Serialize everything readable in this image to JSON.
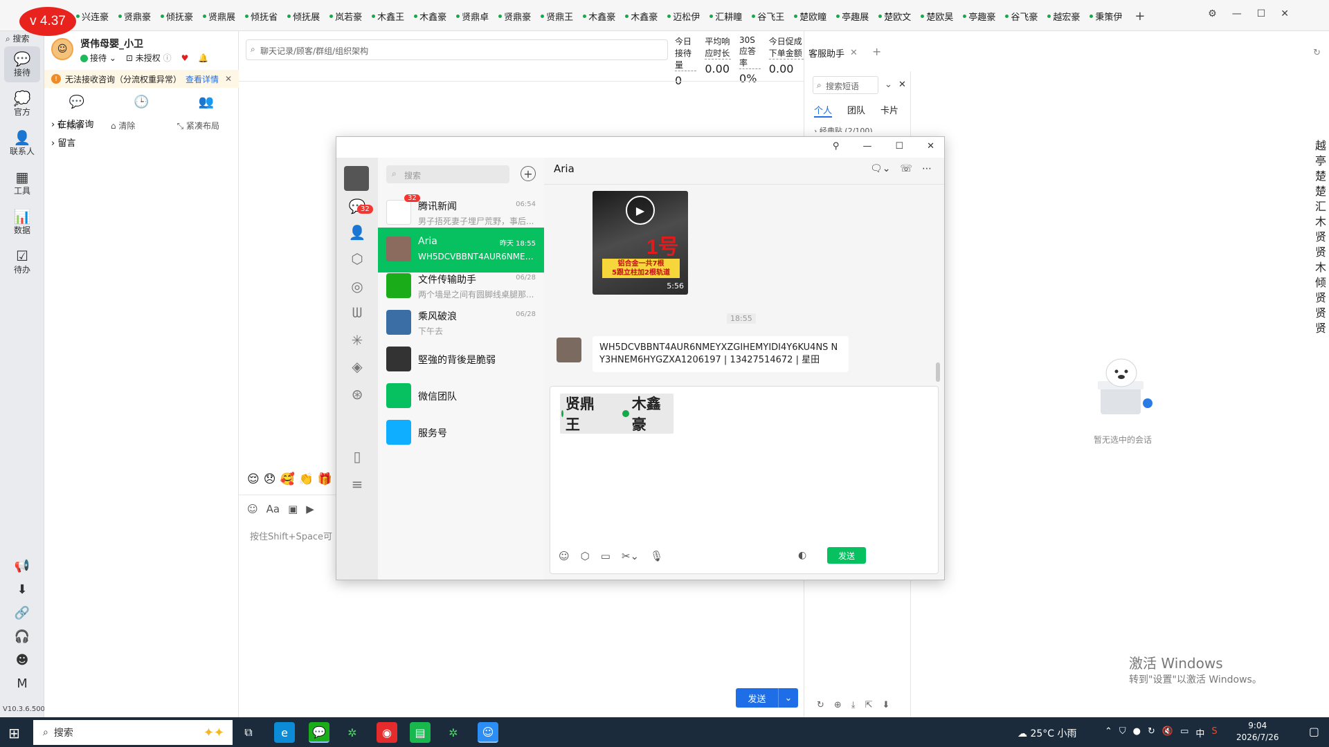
{
  "app": {
    "version_badge": "v 4.37",
    "tabs": [
      "兴连豪",
      "贤鼎豪",
      "倾抚豪",
      "贤鼎展",
      "倾抚省",
      "倾抚展",
      "岚若豪",
      "木鑫王",
      "木鑫豪",
      "贤鼎卓",
      "贤鼎豪",
      "贤鼎王",
      "木鑫豪",
      "木鑫豪",
      "迈松伊",
      "汇耕瞳",
      "谷飞王",
      "楚欧瞳",
      "亭趣展",
      "楚欧文",
      "楚欧昊",
      "亭趣豪",
      "谷飞豪",
      "越宏豪",
      "秉策伊"
    ],
    "window_controls": [
      "⚙",
      "—",
      "☐",
      "✕"
    ]
  },
  "rail": {
    "search": "搜索",
    "items": [
      {
        "icon": "💬",
        "label": "接待"
      },
      {
        "icon": "💭",
        "label": "官方"
      },
      {
        "icon": "👤",
        "label": "联系人"
      },
      {
        "icon": "▦",
        "label": "工具"
      },
      {
        "icon": "📊",
        "label": "数据"
      },
      {
        "icon": "☑",
        "label": "待办"
      }
    ],
    "bottom_icons": [
      "📢",
      "⬇",
      "🔗",
      "🎧",
      "☻",
      "M"
    ],
    "version": "V10.3.6.500"
  },
  "agent": {
    "name": "贤伟母婴_小卫",
    "status": "接待",
    "auth": "未授权",
    "warning": "无法接收咨询（分流权重异常）",
    "warning_link": "查看详情",
    "tools": {
      "sort": "排序",
      "clear": "清除",
      "compact": "紧凑布局"
    },
    "tree": [
      "在线咨询",
      "留言"
    ]
  },
  "center": {
    "search_placeholder": "聊天记录/顾客/群组/组织架构",
    "stats": [
      {
        "label": "今日接待量",
        "value": "0"
      },
      {
        "label": "平均响应时长",
        "value": "0.00"
      },
      {
        "label": "30S应答率",
        "value": "0%"
      },
      {
        "label": "今日促成下单金额",
        "value": "0.00"
      }
    ],
    "emojis": "😌😞🥰👏🎁",
    "composer_hint": "按住Shift+Space可",
    "send": "发送"
  },
  "assistant": {
    "tab": "客服助手",
    "search": "搜索短语",
    "tabs": [
      "个人",
      "团队",
      "卡片"
    ],
    "group": "经典贴 (2/100)",
    "empty": "暂无选中的会话"
  },
  "watermark_right": "越亭楚楚汇木贤贤木倾贤贤贤",
  "activate": {
    "line1": "激活 Windows",
    "line2": "转到\"设置\"以激活 Windows。"
  },
  "wechat": {
    "search": "搜索",
    "unread_badge": "32",
    "conversations": [
      {
        "name": "腾讯新闻",
        "time": "06:54",
        "preview": "男子捂死妻子埋尸荒野，事后...",
        "badge": "32",
        "color": "#ffffff"
      },
      {
        "name": "Aria",
        "time": "昨天 18:55",
        "preview": "WH5DCVBBNT4AUR6NMEY...",
        "badge": "",
        "color": "#8a6b5e"
      },
      {
        "name": "文件传输助手",
        "time": "06/28",
        "preview": "两个墙是之间有圆脚线桌腿那...",
        "badge": "",
        "color": "#1aad19"
      },
      {
        "name": "乘风破浪",
        "time": "06/28",
        "preview": "下午去",
        "badge": "",
        "color": "#3a6ea5"
      },
      {
        "name": "堅強的背後是脆弱",
        "time": "",
        "preview": "",
        "badge": "",
        "color": "#333333"
      },
      {
        "name": "微信团队",
        "time": "",
        "preview": "",
        "badge": "",
        "color": "#07c160"
      },
      {
        "name": "服务号",
        "time": "",
        "preview": "",
        "badge": "",
        "color": "#10aeff"
      }
    ],
    "chat_title": "Aria",
    "video": {
      "big": "1号",
      "caption": "铝合金一共7根\n5跟立柱加2根轨道",
      "duration": "5:56"
    },
    "time": "18:55",
    "message": "WH5DCVBBNT4AUR6NMEYXZGIHEMYIDI4Y6KU4NS NY3HNEM6HYGZXA1206197 | 13427514672 | 星田",
    "paste": [
      "贤鼎王",
      "木鑫豪"
    ],
    "send": "发送"
  },
  "taskbar": {
    "search": "搜索",
    "weather": "25°C 小雨",
    "time": "9:04",
    "date": "2026/7/26",
    "ime": "中"
  }
}
